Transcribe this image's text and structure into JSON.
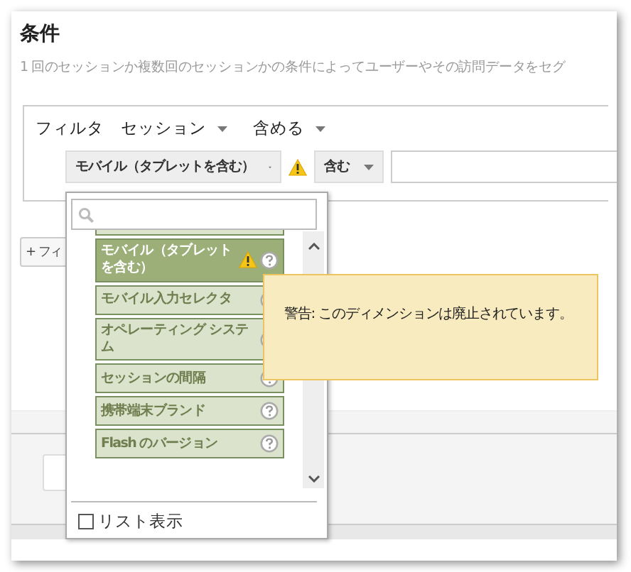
{
  "section": {
    "title": "条件",
    "description": "1 回のセッションか複数回のセッションかの条件によってユーザーやその訪問データをセグ"
  },
  "filter": {
    "label": "フィルタ",
    "scope": "セッション",
    "mode": "含める",
    "dimension": "モバイル（タブレットを含む）",
    "dimension_warning": true,
    "operator": "含む"
  },
  "add_filter_button": "+ フィ",
  "dropdown": {
    "items": [
      {
        "label": "モバイル（タブレットを含む）",
        "selected": true,
        "warning": true
      },
      {
        "label": "モバイル入力セレクタ",
        "selected": false,
        "warning": false
      },
      {
        "label": "オペレーティング システム",
        "selected": false,
        "warning": false
      },
      {
        "label": "セッションの間隔",
        "selected": false,
        "warning": false
      },
      {
        "label": "携帯端末ブランド",
        "selected": false,
        "warning": false
      },
      {
        "label": "Flash のバージョン",
        "selected": false,
        "warning": false
      }
    ],
    "list_view": {
      "label": "リスト表示",
      "checked": false
    }
  },
  "tooltip": {
    "text": "警告: このディメンションは廃止されています。"
  }
}
